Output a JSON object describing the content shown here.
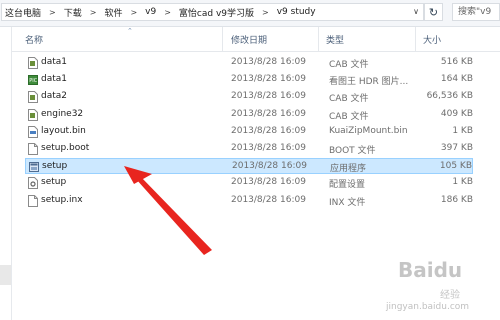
{
  "address_bar": {
    "crumbs": [
      "这台电脑",
      "下载",
      "软件",
      "v9",
      "富怡cad v9学习版",
      "v9 study"
    ],
    "search_placeholder": "搜索\"v9"
  },
  "columns": {
    "name": "名称",
    "date": "修改日期",
    "type": "类型",
    "size": "大小"
  },
  "files": [
    {
      "name": "data1",
      "date": "2013/8/28 16:09",
      "type": "CAB 文件",
      "size": "516 KB",
      "icon": "cab-file-icon",
      "selected": false
    },
    {
      "name": "data1",
      "date": "2013/8/28 16:09",
      "type": "看图王 HDR 图片...",
      "size": "164 KB",
      "icon": "image-file-icon",
      "selected": false
    },
    {
      "name": "data2",
      "date": "2013/8/28 16:09",
      "type": "CAB 文件",
      "size": "66,536 KB",
      "icon": "cab-file-icon",
      "selected": false
    },
    {
      "name": "engine32",
      "date": "2013/8/28 16:09",
      "type": "CAB 文件",
      "size": "409 KB",
      "icon": "cab-file-icon",
      "selected": false
    },
    {
      "name": "layout.bin",
      "date": "2013/8/28 16:09",
      "type": "KuaiZipMount.bin",
      "size": "1 KB",
      "icon": "bin-file-icon",
      "selected": false
    },
    {
      "name": "setup.boot",
      "date": "2013/8/28 16:09",
      "type": "BOOT 文件",
      "size": "397 KB",
      "icon": "file-icon",
      "selected": false
    },
    {
      "name": "setup",
      "date": "2013/8/28 16:09",
      "type": "应用程序",
      "size": "105 KB",
      "icon": "application-icon",
      "selected": true
    },
    {
      "name": "setup",
      "date": "2013/8/28 16:09",
      "type": "配置设置",
      "size": "1 KB",
      "icon": "settings-file-icon",
      "selected": false
    },
    {
      "name": "setup.inx",
      "date": "2013/8/28 16:09",
      "type": "INX 文件",
      "size": "186 KB",
      "icon": "file-icon",
      "selected": false
    }
  ],
  "watermark": {
    "brand": "Baidu",
    "sub": "经验",
    "url": "jingyan.baidu.com"
  },
  "colors": {
    "selection_bg": "#cce8ff",
    "selection_border": "#99d1ff",
    "arrow": "#e8251f",
    "header_text": "#4c607a"
  }
}
